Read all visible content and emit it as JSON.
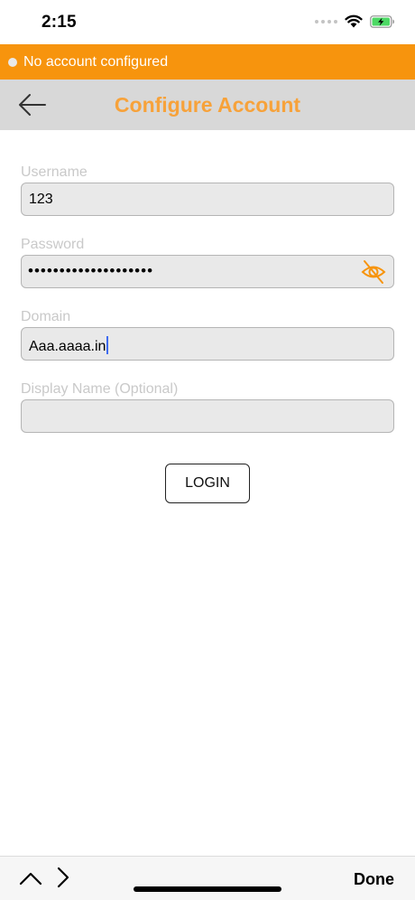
{
  "status_bar": {
    "time": "2:15",
    "icons": [
      "signal-dots",
      "wifi-icon",
      "battery-charging-icon"
    ]
  },
  "banner": {
    "text": "No account configured",
    "color": "#f7940d"
  },
  "nav": {
    "title": "Configure Account",
    "title_color": "#f7a23a",
    "back_icon": "arrow-left-icon"
  },
  "form": {
    "username": {
      "label": "Username",
      "value": "123"
    },
    "password": {
      "label": "Password",
      "value": "••••••••••••••••••••",
      "toggle_icon": "eye-slash-icon"
    },
    "domain": {
      "label": "Domain",
      "value": "Aaa.aaaa.in"
    },
    "display_name": {
      "label": "Display Name (Optional)",
      "value": ""
    },
    "login_label": "LOGIN"
  },
  "keyboard_toolbar": {
    "prev_icon": "chevron-up-icon",
    "next_icon": "chevron-right-icon",
    "done_label": "Done"
  }
}
